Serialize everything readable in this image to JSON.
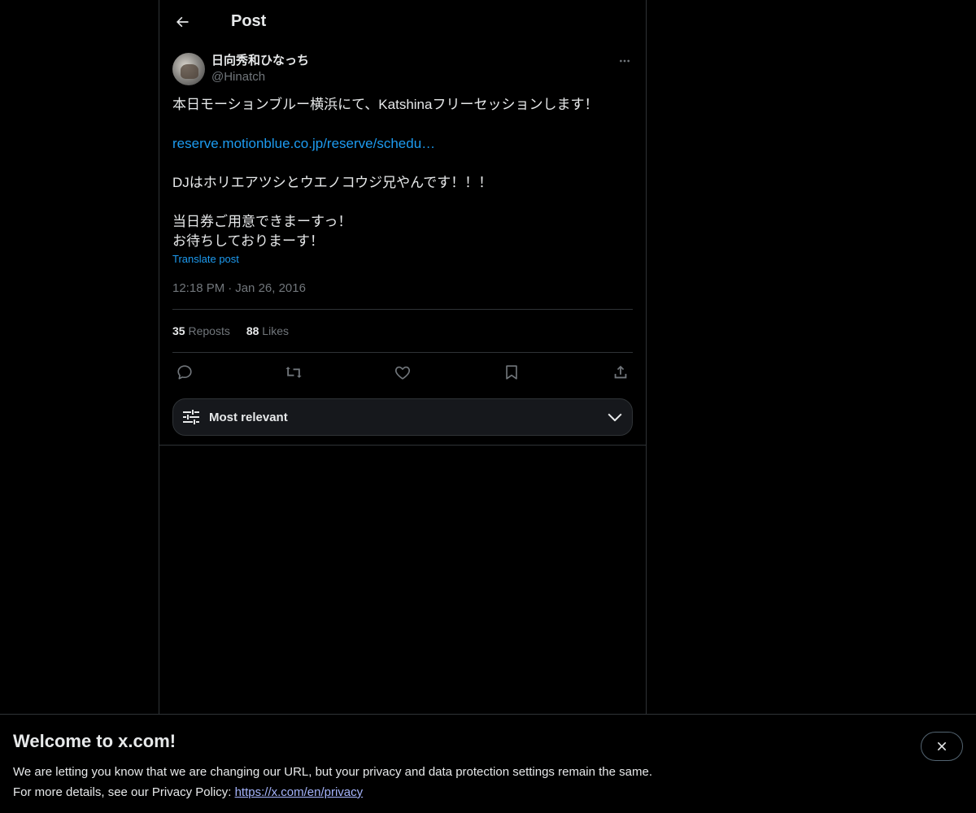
{
  "header": {
    "title": "Post"
  },
  "post": {
    "display_name": "日向秀和ひなっち",
    "handle": "@Hinatch",
    "text_lines": [
      "本日モーションブルー横浜にて、Katshinaフリーセッションします！",
      "",
      "reserve.motionblue.co.jp/reserve/schedu…",
      "",
      "DJはホリエアツシとウエノコウジ兄やんです！！！",
      "",
      "当日券ご用意できまーすっ！",
      "お待ちしておりまーす！"
    ],
    "translate_label": "Translate post",
    "time": "12:18 PM",
    "separator": "·",
    "date": "Jan 26, 2016"
  },
  "stats": {
    "reposts_count": "35",
    "reposts_label": "Reposts",
    "likes_count": "88",
    "likes_label": "Likes"
  },
  "sort": {
    "label": "Most relevant"
  },
  "banner": {
    "title": "Welcome to x.com!",
    "line1": "We are letting you know that we are changing our URL, but your privacy and data protection settings remain the same.",
    "line2_prefix": "For more details, see our Privacy Policy: ",
    "link_text": "https://x.com/en/privacy"
  },
  "colors": {
    "background": "#000000",
    "text": "#e7e9ea",
    "muted": "#71767b",
    "link": "#1d9bf0",
    "border": "#2f3336"
  },
  "icons": {
    "back": "arrow-left-icon",
    "more": "more-horizontal-icon",
    "reply": "reply-icon",
    "repost": "repost-icon",
    "like": "heart-icon",
    "bookmark": "bookmark-icon",
    "share": "share-icon",
    "sort": "sliders-icon",
    "chevron": "chevron-down-icon",
    "close": "close-icon"
  }
}
